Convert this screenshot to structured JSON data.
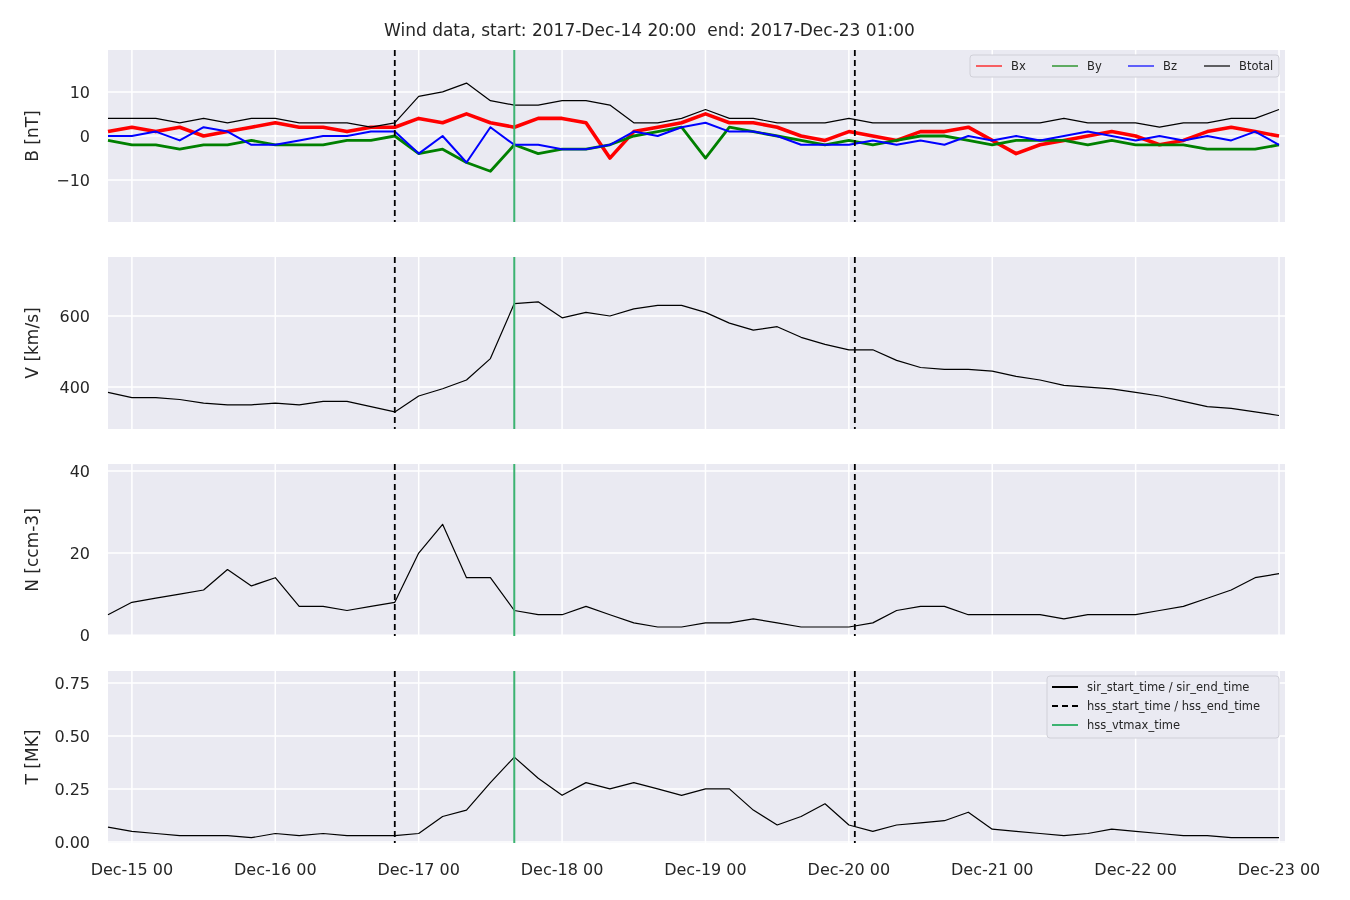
{
  "title": "Wind data, start: 2017-Dec-14 20:00  end: 2017-Dec-23 01:00",
  "panels": [
    {
      "chart_data": {
        "type": "line",
        "grid": true,
        "legend": true,
        "ylabel": "B [nT]",
        "ylim": [
          -19.5,
          19.5
        ],
        "yticks": [
          {
            "value": -10,
            "label": "−10"
          },
          0,
          10
        ],
        "categories": [
          null,
          null,
          null,
          null,
          null,
          null,
          null,
          null,
          null,
          null,
          null,
          null,
          null,
          null,
          null,
          null,
          null,
          null,
          null,
          null,
          null,
          null,
          null,
          null,
          null,
          null,
          null,
          null,
          null,
          null,
          null,
          null,
          null,
          null,
          null,
          null,
          null,
          null,
          null,
          null,
          null,
          null,
          null,
          null,
          null,
          null,
          null,
          null,
          null,
          null
        ],
        "series": [
          {
            "name": "Bx",
            "color": "#ff0000",
            "values": [
              1,
              2,
              1,
              2,
              0,
              1,
              2,
              3,
              2,
              2,
              1,
              2,
              2,
              4,
              3,
              5,
              3,
              2,
              4,
              4,
              3,
              -5,
              1,
              2,
              3,
              5,
              3,
              3,
              2,
              0,
              -1,
              1,
              0,
              -1,
              1,
              1,
              2,
              -1,
              -4,
              -2,
              -1,
              0,
              1,
              0,
              -2,
              -1,
              1,
              2,
              1,
              0
            ]
          },
          {
            "name": "By",
            "color": "#008000",
            "values": [
              -1,
              -2,
              -2,
              -3,
              -2,
              -2,
              -1,
              -2,
              -2,
              -2,
              -1,
              -1,
              0,
              -4,
              -3,
              -6,
              -8,
              -2,
              -4,
              -3,
              -3,
              -2,
              0,
              1,
              2,
              -5,
              2,
              1,
              0,
              -1,
              -2,
              -1,
              -2,
              -1,
              0,
              0,
              -1,
              -2,
              -1,
              -1,
              -1,
              -2,
              -1,
              -2,
              -2,
              -2,
              -3,
              -3,
              -3,
              -2
            ]
          },
          {
            "name": "Bz",
            "color": "#0000ff",
            "values": [
              0,
              0,
              1,
              -1,
              2,
              1,
              -2,
              -2,
              -1,
              0,
              0,
              1,
              1,
              -4,
              0,
              -6,
              2,
              -2,
              -2,
              -3,
              -3,
              -2,
              1,
              0,
              2,
              3,
              1,
              1,
              0,
              -2,
              -2,
              -2,
              -1,
              -2,
              -1,
              -2,
              0,
              -1,
              0,
              -1,
              0,
              1,
              0,
              -1,
              0,
              -1,
              0,
              -1,
              1,
              -2
            ]
          },
          {
            "name": "Btotal",
            "color": "#000000",
            "values": [
              4,
              4,
              4,
              3,
              4,
              3,
              4,
              4,
              3,
              3,
              3,
              2,
              3,
              9,
              10,
              12,
              8,
              7,
              7,
              8,
              8,
              7,
              3,
              3,
              4,
              6,
              4,
              4,
              3,
              3,
              3,
              4,
              3,
              3,
              3,
              3,
              3,
              3,
              3,
              3,
              4,
              3,
              3,
              3,
              2,
              3,
              3,
              4,
              4,
              6
            ]
          }
        ]
      }
    },
    {
      "chart_data": {
        "type": "line",
        "grid": true,
        "ylabel": "V [km/s]",
        "ylim": [
          282,
          766
        ],
        "yticks": [
          400,
          600
        ],
        "categories": [
          null,
          null,
          null,
          null,
          null,
          null,
          null,
          null,
          null,
          null,
          null,
          null,
          null,
          null,
          null,
          null,
          null,
          null,
          null,
          null,
          null,
          null,
          null,
          null,
          null,
          null,
          null,
          null,
          null,
          null,
          null,
          null,
          null,
          null,
          null,
          null,
          null,
          null,
          null,
          null,
          null,
          null,
          null,
          null,
          null,
          null,
          null,
          null,
          null,
          null
        ],
        "values": [
          385,
          370,
          370,
          365,
          355,
          350,
          350,
          355,
          350,
          360,
          360,
          345,
          330,
          375,
          395,
          420,
          480,
          635,
          640,
          595,
          610,
          600,
          620,
          630,
          630,
          610,
          580,
          560,
          570,
          540,
          520,
          505,
          505,
          475,
          455,
          450,
          450,
          445,
          430,
          420,
          405,
          400,
          395,
          385,
          375,
          360,
          345,
          340,
          330,
          320
        ]
      }
    },
    {
      "chart_data": {
        "type": "line",
        "grid": true,
        "ylabel": "N [ccm-3]",
        "ylim": [
          -0.2,
          41.7
        ],
        "yticks": [
          0,
          20,
          40
        ],
        "categories": [
          null,
          null,
          null,
          null,
          null,
          null,
          null,
          null,
          null,
          null,
          null,
          null,
          null,
          null,
          null,
          null,
          null,
          null,
          null,
          null,
          null,
          null,
          null,
          null,
          null,
          null,
          null,
          null,
          null,
          null,
          null,
          null,
          null,
          null,
          null,
          null,
          null,
          null,
          null,
          null,
          null,
          null,
          null,
          null,
          null,
          null,
          null,
          null,
          null,
          null
        ],
        "values": [
          5,
          8,
          9,
          10,
          11,
          16,
          12,
          14,
          7,
          7,
          6,
          7,
          8,
          20,
          27,
          14,
          14,
          6,
          5,
          5,
          7,
          5,
          3,
          2,
          2,
          3,
          3,
          4,
          3,
          2,
          2,
          2,
          3,
          6,
          7,
          7,
          5,
          5,
          5,
          5,
          4,
          5,
          5,
          5,
          6,
          7,
          9,
          11,
          14,
          15
        ]
      }
    },
    {
      "chart_data": {
        "type": "line",
        "grid": true,
        "ylabel": "T [MK]",
        "ylim": [
          -0.005,
          0.806
        ],
        "yticks": [
          {
            "value": 0,
            "label": "0.00"
          },
          {
            "value": 0.25,
            "label": "0.25"
          },
          {
            "value": 0.5,
            "label": "0.50"
          },
          {
            "value": 0.75,
            "label": "0.75"
          }
        ],
        "categories": [
          null,
          "Dec-15 00",
          null,
          null,
          null,
          null,
          null,
          "Dec-16 00",
          null,
          null,
          null,
          null,
          null,
          "Dec-17 00",
          null,
          null,
          null,
          null,
          null,
          "Dec-18 00",
          null,
          null,
          null,
          null,
          null,
          "Dec-19 00",
          null,
          null,
          null,
          null,
          null,
          "Dec-20 00",
          null,
          null,
          null,
          null,
          null,
          "Dec-21 00",
          null,
          null,
          null,
          null,
          null,
          "Dec-22 00",
          null,
          null,
          null,
          null,
          null,
          "Dec-23 00"
        ],
        "values": [
          0.07,
          0.05,
          0.04,
          0.03,
          0.03,
          0.03,
          0.02,
          0.04,
          0.03,
          0.04,
          0.03,
          0.03,
          0.03,
          0.04,
          0.12,
          0.15,
          0.28,
          0.4,
          0.3,
          0.22,
          0.28,
          0.25,
          0.28,
          0.25,
          0.22,
          0.25,
          0.25,
          0.15,
          0.08,
          0.12,
          0.18,
          0.08,
          0.05,
          0.08,
          0.09,
          0.1,
          0.14,
          0.06,
          0.05,
          0.04,
          0.03,
          0.04,
          0.06,
          0.05,
          0.04,
          0.03,
          0.03,
          0.02,
          0.02,
          0.02
        ]
      },
      "legend": [
        {
          "kind": "solid",
          "label": "sir_start_time / sir_end_time"
        },
        {
          "kind": "dashed",
          "label": "hss_start_time / hss_end_time"
        },
        {
          "kind": "vtmax",
          "label": "hss_vtmax_time"
        }
      ]
    }
  ]
}
